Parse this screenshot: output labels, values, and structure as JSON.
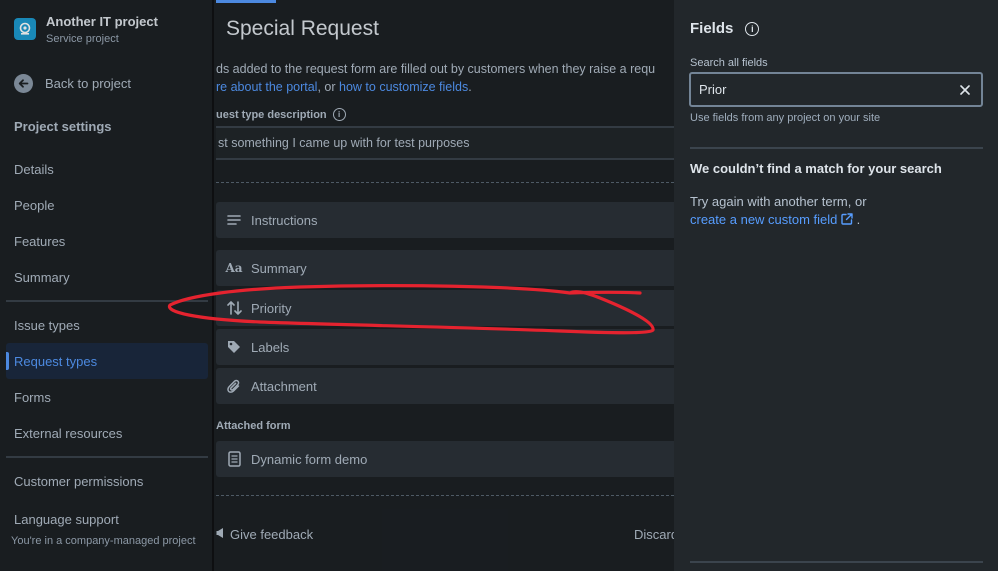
{
  "sidebar": {
    "project_name": "Another IT project",
    "project_type": "Service project",
    "back_label": "Back to project",
    "section_title": "Project settings",
    "group1": [
      "Details",
      "People",
      "Features",
      "Summary"
    ],
    "group2": [
      "Issue types",
      "Request types",
      "Forms",
      "External resources"
    ],
    "group3": [
      "Customer permissions",
      "Language support"
    ],
    "active_item": "Request types",
    "footer": "You're in a company-managed project"
  },
  "main": {
    "title": "Special Request",
    "desc_text_1": "ds added to the request form are filled out by customers when they raise a requ",
    "desc_link_1": "re about the portal",
    "desc_text_2": ", or ",
    "desc_link_2": "how to customize fields",
    "desc_text_3": ".",
    "field_label": "uest type description",
    "description_value": "st something I came up with for test purposes",
    "fields": [
      {
        "label": "Instructions",
        "icon": "instructions-icon"
      },
      {
        "label": "Summary",
        "icon": "text-icon"
      },
      {
        "label": "Priority",
        "icon": "priority-icon"
      },
      {
        "label": "Labels",
        "icon": "tag-icon"
      },
      {
        "label": "Attachment",
        "icon": "paperclip-icon"
      }
    ],
    "attached_form_label": "Attached form",
    "attached_form": "Dynamic form demo",
    "feedback_label": "Give feedback",
    "discard_label": "Discard"
  },
  "panel": {
    "title": "Fields",
    "search_label": "Search all fields",
    "search_value": "Prior",
    "helper": "Use fields from any project on your site",
    "no_match_title": "We couldn’t find a match for your search",
    "try_again": "Try again with another term, or",
    "create_link": "create a new custom field",
    "create_suffix": "."
  },
  "colors": {
    "background": "#1d2125",
    "panel": "#22272b",
    "accent": "#579dff",
    "annotation": "#e5232f"
  }
}
